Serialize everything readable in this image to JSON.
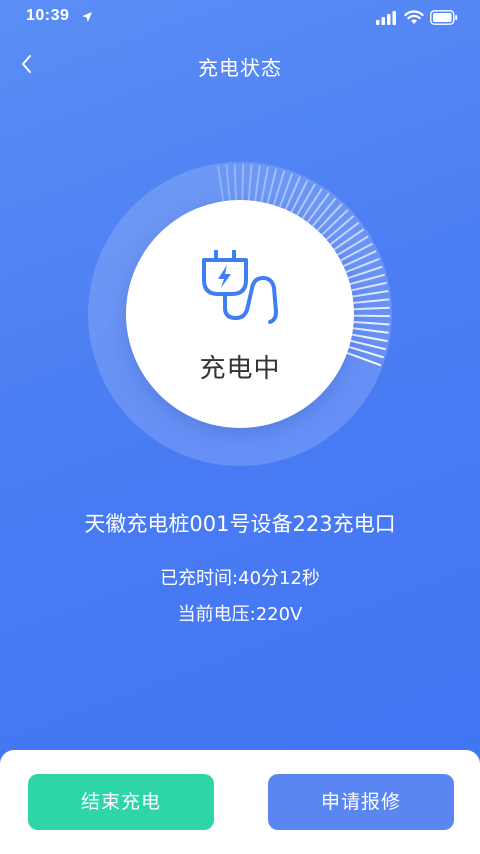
{
  "status_bar": {
    "time": "10:39"
  },
  "header": {
    "title": "充电状态"
  },
  "gauge": {
    "status_label": "充电中",
    "progress": 0.33
  },
  "info": {
    "device_name": "天徽充电桩001号设备223充电口",
    "charge_time": "已充时间:40分12秒",
    "voltage": "当前电压:220V"
  },
  "actions": {
    "end_charge": "结束充电",
    "request_repair": "申请报修"
  },
  "colors": {
    "background": "#4a7cf3",
    "end_button": "#2ed5a6",
    "repair_button": "#5a86f1",
    "icon": "#3f7ff0"
  }
}
